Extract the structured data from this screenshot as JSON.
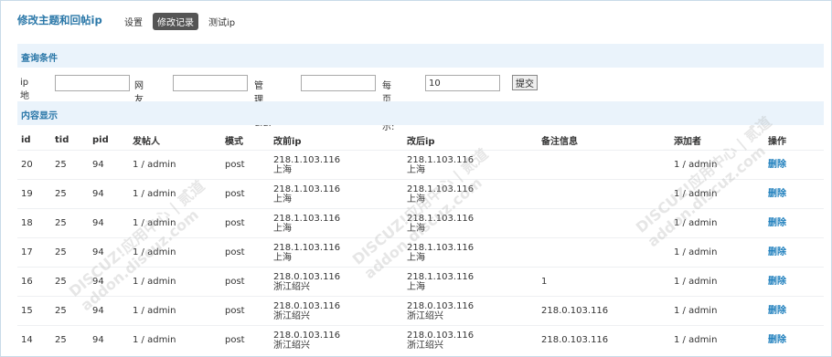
{
  "header": {
    "title": "修改主题和回帖ip",
    "tabs": [
      {
        "label": "设置"
      },
      {
        "label": "修改记录"
      },
      {
        "label": "测试ip"
      }
    ]
  },
  "query": {
    "section_title": "查询条件",
    "ip_label": "ip地址:",
    "ip_value": "",
    "uid_label": "网友uid:",
    "uid_value": "",
    "admin_uid_label": "管理员uid:",
    "admin_uid_value": "",
    "per_page_label": "每页显示:",
    "per_page_value": "10",
    "submit_label": "提交"
  },
  "content": {
    "section_title": "内容显示",
    "columns": [
      "id",
      "tid",
      "pid",
      "发帖人",
      "模式",
      "改前ip",
      "改后ip",
      "备注信息",
      "添加者",
      "操作"
    ],
    "rows": [
      {
        "id": "20",
        "tid": "25",
        "pid": "94",
        "poster": "1 / admin",
        "mode": "post",
        "before_ip": "218.1.103.116",
        "before_loc": "上海",
        "after_ip": "218.1.103.116",
        "after_loc": "上海",
        "note": "",
        "adder": "1 / admin",
        "action": "删除"
      },
      {
        "id": "19",
        "tid": "25",
        "pid": "94",
        "poster": "1 / admin",
        "mode": "post",
        "before_ip": "218.1.103.116",
        "before_loc": "上海",
        "after_ip": "218.1.103.116",
        "after_loc": "上海",
        "note": "",
        "adder": "1 / admin",
        "action": "删除"
      },
      {
        "id": "18",
        "tid": "25",
        "pid": "94",
        "poster": "1 / admin",
        "mode": "post",
        "before_ip": "218.1.103.116",
        "before_loc": "上海",
        "after_ip": "218.1.103.116",
        "after_loc": "上海",
        "note": "",
        "adder": "1 / admin",
        "action": "删除"
      },
      {
        "id": "17",
        "tid": "25",
        "pid": "94",
        "poster": "1 / admin",
        "mode": "post",
        "before_ip": "218.1.103.116",
        "before_loc": "上海",
        "after_ip": "218.1.103.116",
        "after_loc": "上海",
        "note": "",
        "adder": "1 / admin",
        "action": "删除"
      },
      {
        "id": "16",
        "tid": "25",
        "pid": "94",
        "poster": "1 / admin",
        "mode": "post",
        "before_ip": "218.0.103.116",
        "before_loc": "浙江绍兴",
        "after_ip": "218.1.103.116",
        "after_loc": "上海",
        "note": "1",
        "adder": "1 / admin",
        "action": "删除"
      },
      {
        "id": "15",
        "tid": "25",
        "pid": "94",
        "poster": "1 / admin",
        "mode": "post",
        "before_ip": "218.0.103.116",
        "before_loc": "浙江绍兴",
        "after_ip": "218.0.103.116",
        "after_loc": "浙江绍兴",
        "note": "218.0.103.116",
        "adder": "1 / admin",
        "action": "删除"
      },
      {
        "id": "14",
        "tid": "25",
        "pid": "94",
        "poster": "1 / admin",
        "mode": "post",
        "before_ip": "218.0.103.116",
        "before_loc": "浙江绍兴",
        "after_ip": "218.0.103.116",
        "after_loc": "浙江绍兴",
        "note": "218.0.103.116",
        "adder": "1 / admin",
        "action": "删除"
      }
    ]
  },
  "watermark": {
    "line1": "DISCUZ!应用中心 | 贰道",
    "line2": "addon.discuz.com"
  }
}
